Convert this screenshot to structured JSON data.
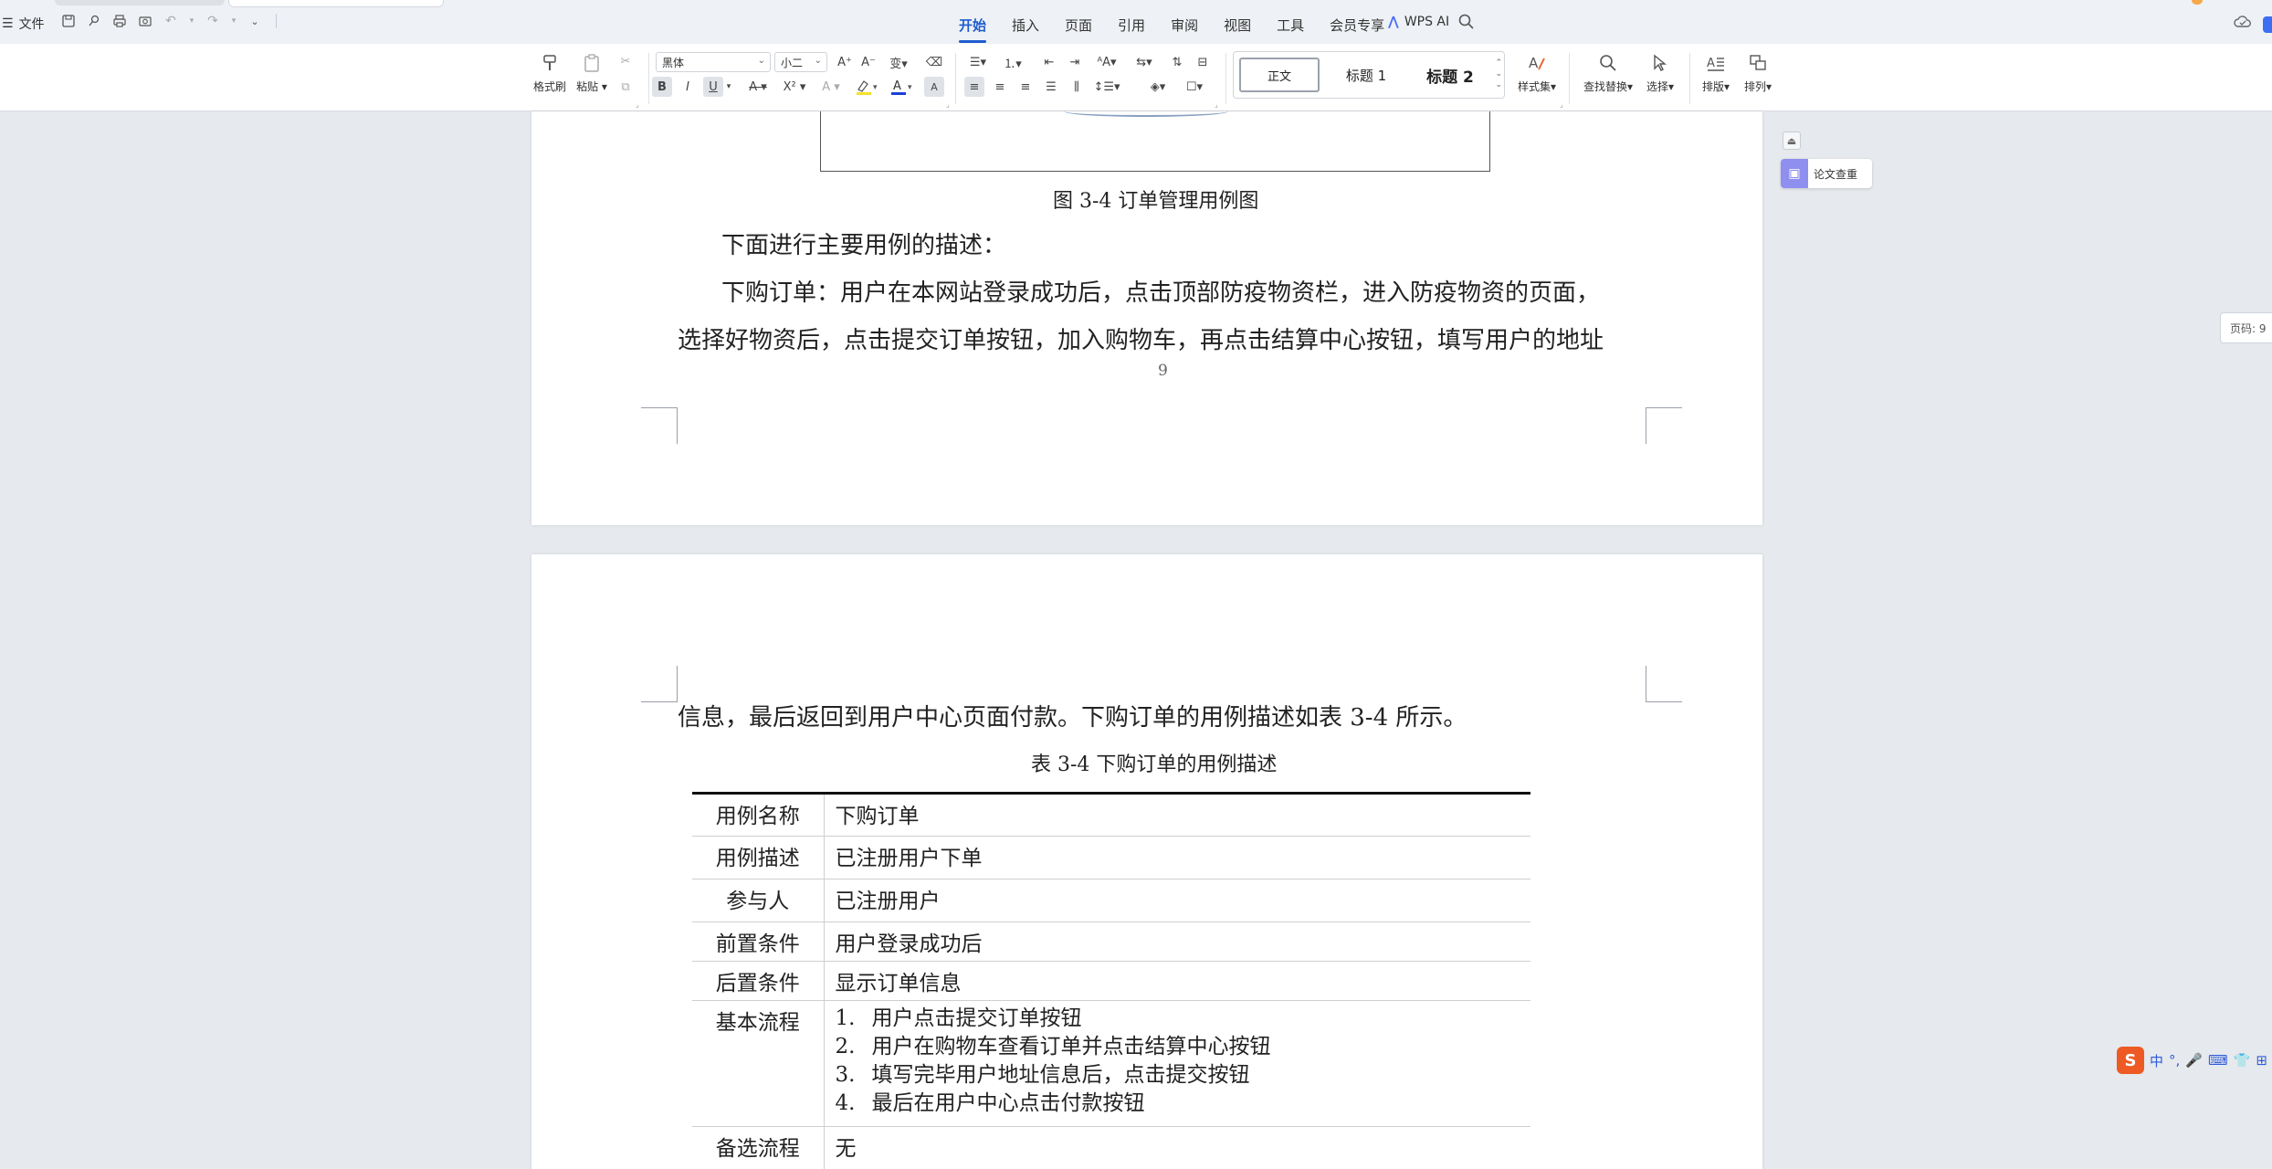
{
  "menubar": {
    "file_label": "文件",
    "tabs": [
      "开始",
      "插入",
      "页面",
      "引用",
      "审阅",
      "视图",
      "工具",
      "会员专享"
    ],
    "active_tab": "开始",
    "wps_ai_label": "WPS AI"
  },
  "ribbon": {
    "format_painter": "格式刷",
    "paste": "粘贴",
    "font_name": "黑体",
    "font_size": "小二",
    "styles": [
      "正文",
      "标题 1",
      "标题 2"
    ],
    "style_set": "样式集",
    "find_replace": "查找替换",
    "select": "选择",
    "layout": "排版",
    "arrange": "排列"
  },
  "document": {
    "figure_caption": "图 3-4  订单管理用例图",
    "intro": "下面进行主要用例的描述：",
    "para_line1": "下购订单：用户在本网站登录成功后，点击顶部防疫物资栏，进入防疫物资的页面，",
    "para_line2": "选择好物资后，点击提交订单按钮，加入购物车，再点击结算中心按钮，填写用户的地址",
    "page_number": "9",
    "para_cont": "信息，最后返回到用户中心页面付款。下购订单的用例描述如表 3-4 所示。",
    "table_caption": "表 3-4  下购订单的用例描述",
    "table": {
      "rows": [
        {
          "key": "用例名称",
          "value": "下购订单"
        },
        {
          "key": "用例描述",
          "value": "已注册用户下单"
        },
        {
          "key": "参与人",
          "value": "已注册用户"
        },
        {
          "key": "前置条件",
          "value": "用户登录成功后"
        },
        {
          "key": "后置条件",
          "value": "显示订单信息"
        }
      ],
      "flow_key": "基本流程",
      "flow_nums": [
        "1.",
        "2.",
        "3.",
        "4."
      ],
      "flow_steps": [
        "用户点击提交订单按钮",
        "用户在购物车查看订单并点击结算中心按钮",
        "填写完毕用户地址信息后，点击提交按钮",
        "最后在用户中心点击付款按钮"
      ],
      "alt_key": "备选流程",
      "alt_value": "无"
    }
  },
  "side": {
    "paper_check": "论文查重",
    "page_indicator": "页码: 9"
  },
  "ime": {
    "logo": "S",
    "mode": "中"
  },
  "colors": {
    "accent": "#1f5ccf",
    "canvas": "#e6e9ed",
    "menubar": "#eef1f5"
  }
}
